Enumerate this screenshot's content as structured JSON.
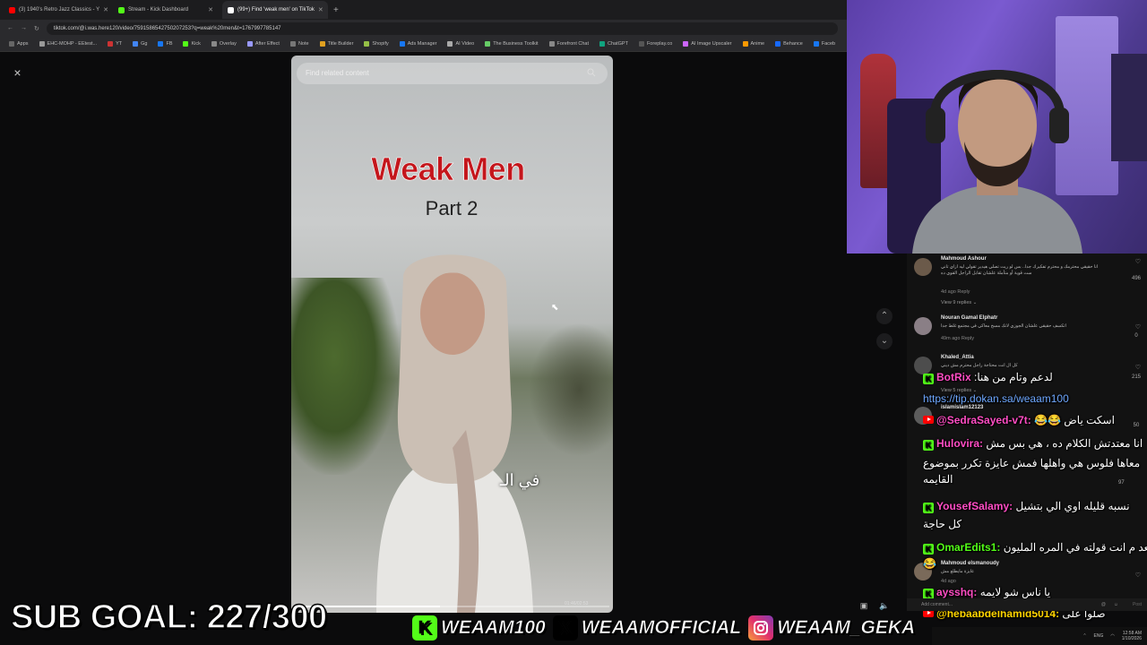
{
  "browser": {
    "tabs": [
      {
        "title": "(3) 1940's Retro Jazz Classics - Y",
        "color": "#ff0000",
        "active": false
      },
      {
        "title": "Stream - Kick Dashboard",
        "color": "#53fc18",
        "active": false
      },
      {
        "title": "(99+) Find 'weak men' on TikTok",
        "color": "#ffffff",
        "active": true
      }
    ],
    "new_tab": "+",
    "url": "tiktok.com/@i.was.here120/video/7591586542750207253?q=weak%20men&t=1767997785147",
    "bookmarks": [
      "Apps",
      "EHC-MOHP - EEtest...",
      "YT",
      "Gg",
      "FB",
      "Kick",
      "Overlay",
      "After Effect",
      "Note",
      "Title Builder",
      "Shopify",
      "Ads Manager",
      "AI Video",
      "The Business Toolkit",
      "Forefront Chat",
      "ChatGPT",
      "Foreplay.co",
      "AI Image Upscaler",
      "Anime",
      "Behance",
      "Faceb"
    ]
  },
  "viewer": {
    "close_icon": "×",
    "search_placeholder": "Find related content",
    "video_title": "Weak Men",
    "video_subtitle": "Part 2",
    "caption": "في الـ",
    "progress": 0.46,
    "timestamp": "01:46/02:53",
    "nav_up": "⌃",
    "nav_down": "⌄"
  },
  "comments": [
    {
      "name": "Mahmoud Ashour",
      "text": "انا حقيقي محترمك و محترم تفكيرك جدا.. بس لو ريت تصلي هيدير تقولي ليه ازاي تاني ست قوية أو متأملة علشان تقابل الراجل القوي ده",
      "meta": "4d ago   Reply",
      "likes": "496",
      "replies": "View 9 replies ⌄"
    },
    {
      "name": "Nouran Gamal Elphatr",
      "text": "اتكسف حقيقي علشان الجوزي لانك مسح معاكي في مجتمع غلط جدا",
      "meta": "49m ago   Reply",
      "likes": "0",
      "replies": ""
    },
    {
      "name": "Khaled_Attia",
      "text": "كل ال انت محتاجة راجل محترم مش ديني",
      "meta": "",
      "likes": "215",
      "replies": "View 5 replies ⌄"
    },
    {
      "name": "islamislam12123",
      "text": "",
      "meta": "",
      "likes": "50",
      "replies": ""
    },
    {
      "name": "Mahmoud elsmanoudy",
      "text": "عايزة مايطلع مش",
      "meta": "4d ago",
      "likes": "97",
      "replies": ""
    }
  ],
  "chat": [
    {
      "badge": "kick",
      "user": "BotRix",
      "user_color": "#ff4dc4",
      "msg": "لدعم وتام من هنا:"
    },
    {
      "badge": "",
      "user": "",
      "user_color": "#6fa8ff",
      "msg": "https://tip.dokan.sa/weaam100",
      "link": true
    },
    {
      "badge": "yt",
      "user": "@SedraSayed-v7t:",
      "user_color": "#ff4dc4",
      "msg": "اسكت ياض 😂😂"
    },
    {
      "badge": "kick",
      "user": "Hulovira:",
      "user_color": "#ff4dc4",
      "msg": "انا معتدتش الكلام ده ، هي بس مش"
    },
    {
      "badge": "",
      "user": "",
      "user_color": "#ffffff",
      "msg": "معاها فلوس هي واهلها فمش عايزة تكرر بموضوع"
    },
    {
      "badge": "",
      "user": "",
      "user_color": "#ffffff",
      "msg": "القايمه"
    },
    {
      "badge": "kick",
      "user": "YousefSalamy:",
      "user_color": "#ff4dc4",
      "msg": "نسبه قليله اوي الي بتشيل"
    },
    {
      "badge": "",
      "user": "",
      "user_color": "#ffffff",
      "msg": "كل حاجة"
    },
    {
      "badge": "kick",
      "user": "OmarEdits1:",
      "user_color": "#53fc18",
      "msg": "بعد م انت قولته في المره المليون"
    },
    {
      "badge": "",
      "user": "",
      "user_color": "#ffffff",
      "msg": "😂"
    },
    {
      "badge": "kick",
      "user": "aysshq:",
      "user_color": "#ff4dc4",
      "msg": "يا ناس شو لايمه"
    },
    {
      "badge": "yt",
      "user": "@hebaabdelhamid5014:",
      "user_color": "#ffd400",
      "msg": "صلوا على"
    }
  ],
  "composer_placeholder": "Add comment...",
  "post_label": "Post",
  "overlay": {
    "sub_goal": "SUB GOAL: 227/300",
    "kick_handle": "WEAAM100",
    "x_handle": "WEAAMOFFICIAL",
    "ig_handle": "WEAAM_GEKA"
  },
  "taskbar": {
    "lang": "ENG",
    "time": "12:58 AM",
    "date": "1/10/2026"
  }
}
